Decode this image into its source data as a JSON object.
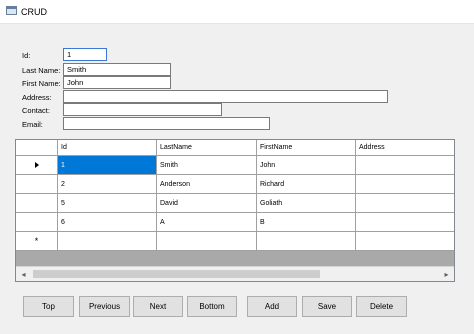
{
  "window": {
    "title": "CRUD",
    "icon": "window-form-icon"
  },
  "form": {
    "id_label": "Id:",
    "id_value": "1",
    "last_name_label": "Last Name:",
    "last_name_value": "Smith",
    "first_name_label": "First Name:",
    "first_name_value": "John",
    "address_label": "Address:",
    "address_value": "",
    "contact_label": "Contact:",
    "contact_value": "",
    "email_label": "Email:",
    "email_value": ""
  },
  "grid": {
    "columns": [
      "Id",
      "LastName",
      "FirstName",
      "Address"
    ],
    "rows": [
      [
        "1",
        "Smith",
        "John",
        ""
      ],
      [
        "2",
        "Anderson",
        "Richard",
        ""
      ],
      [
        "5",
        "David",
        "Goliath",
        ""
      ],
      [
        "6",
        "A",
        "B",
        ""
      ]
    ],
    "current_row_marker_icon": "current-row-triangle-icon",
    "new_row_marker": "*"
  },
  "scrollbar": {
    "left_arrow": "◂",
    "right_arrow": "▸"
  },
  "buttons": {
    "top": "Top",
    "previous": "Previous",
    "next": "Next",
    "bottom": "Bottom",
    "add": "Add",
    "save": "Save",
    "delete": "Delete"
  }
}
